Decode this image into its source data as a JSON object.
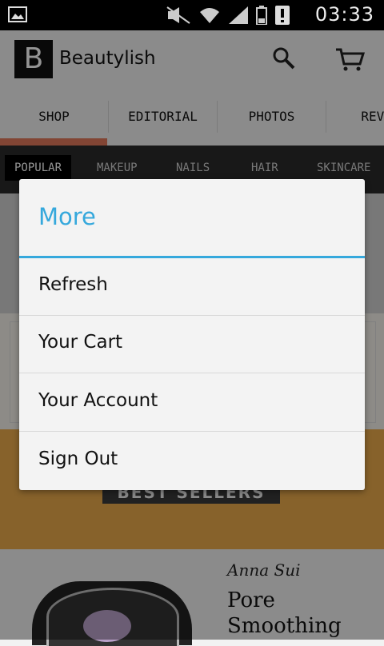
{
  "status_bar": {
    "time": "03:33",
    "icons": [
      "gallery-icon",
      "mute-icon",
      "wifi-icon",
      "signal-icon",
      "battery-icon",
      "alert-icon"
    ]
  },
  "app_bar": {
    "logo_letter": "B",
    "brand": "Beautylish"
  },
  "nav_tabs": [
    "SHOP",
    "EDITORIAL",
    "PHOTOS",
    "REVIE"
  ],
  "category_tabs": [
    "POPULAR",
    "MAKEUP",
    "NAILS",
    "HAIR",
    "SKINCARE"
  ],
  "background_content": {
    "banner_text": "BEST SELLERS",
    "product_brand": "Anna Sui",
    "product_name_line1": "Pore",
    "product_name_line2": "Smoothing"
  },
  "dialog": {
    "title": "More",
    "items": [
      "Refresh",
      "Your Cart",
      "Your Account",
      "Sign Out"
    ],
    "accent_color": "#35a8dc"
  }
}
